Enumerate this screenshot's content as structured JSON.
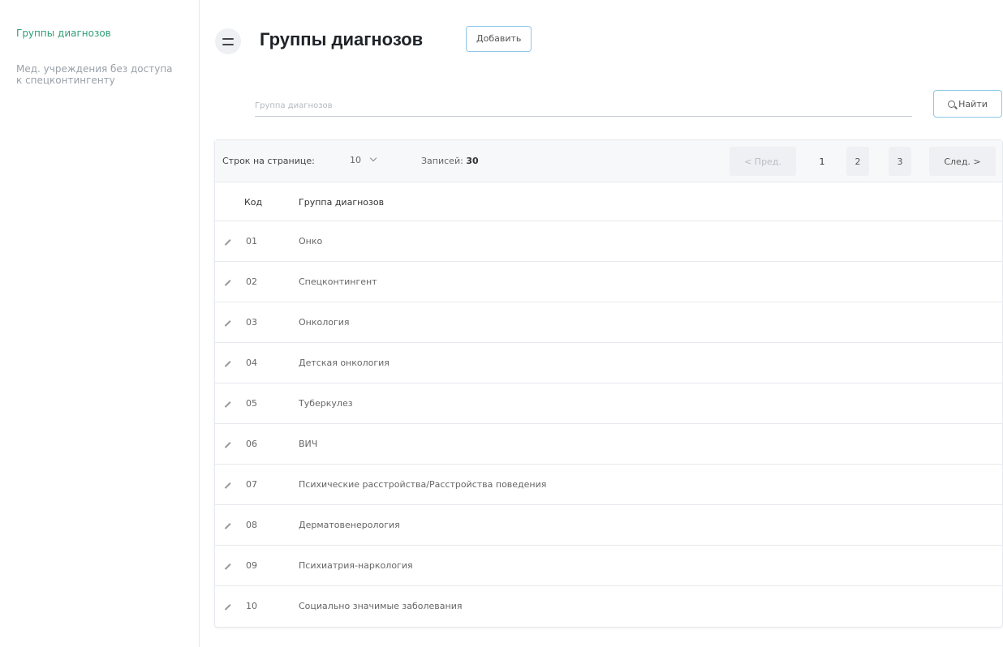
{
  "sidebar": {
    "items": [
      {
        "label": "Группы диагнозов",
        "active": true
      },
      {
        "label": "Мед. учреждения без доступа к спецконтингенту",
        "active": false
      }
    ]
  },
  "header": {
    "menu_icon": "hamburger-icon",
    "title": "Группы диагнозов",
    "add_label": "Добавить"
  },
  "search": {
    "placeholder": "Группа диагнозов",
    "value": "",
    "find_label": "Найти",
    "find_icon": "search-icon"
  },
  "table": {
    "rows_per_page_label": "Строк на странице:",
    "rows_per_page_value": "10",
    "records_label": "Записей:",
    "records_count": "30",
    "pagination": {
      "prev": "< Пред.",
      "pages": [
        "1",
        "2",
        "3"
      ],
      "current_page": "1",
      "next": "След. >"
    },
    "columns": {
      "code": "Код",
      "name": "Группа диагнозов"
    },
    "rows": [
      {
        "code": "01",
        "name": "Онко"
      },
      {
        "code": "02",
        "name": "Спецконтингент"
      },
      {
        "code": "03",
        "name": "Онкология"
      },
      {
        "code": "04",
        "name": "Детская онкология"
      },
      {
        "code": "05",
        "name": "Туберкулез"
      },
      {
        "code": "06",
        "name": "ВИЧ"
      },
      {
        "code": "07",
        "name": "Психические расстройства/Расстройства поведения"
      },
      {
        "code": "08",
        "name": "Дерматовенерология"
      },
      {
        "code": "09",
        "name": "Психиатрия-наркология"
      },
      {
        "code": "10",
        "name": "Социально значимые заболевания"
      }
    ]
  },
  "colors": {
    "accent_green": "#2f9e75",
    "button_border": "#8fc7e8"
  }
}
